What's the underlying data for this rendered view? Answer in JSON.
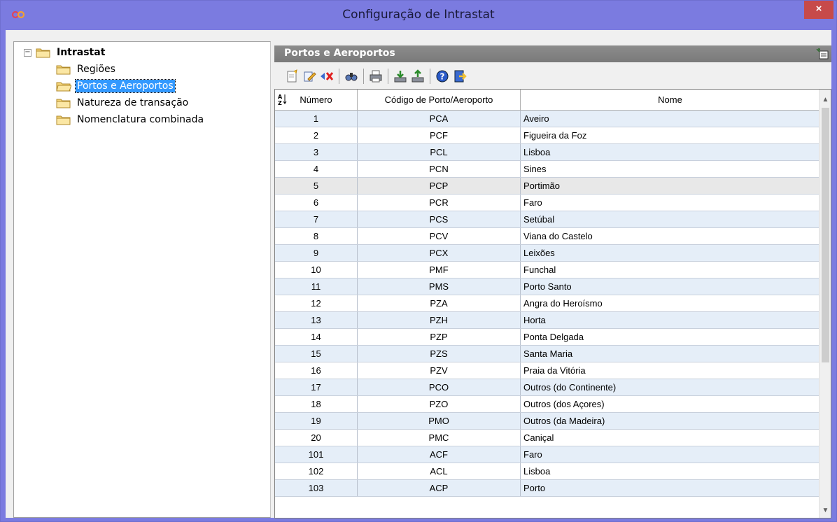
{
  "window": {
    "title": "Configuração de Intrastat",
    "close_label": "×"
  },
  "tree": {
    "root": "Intrastat",
    "expander": "−",
    "items": [
      {
        "label": "Regiões"
      },
      {
        "label": "Portos e Aeroportos",
        "selected": true
      },
      {
        "label": "Natureza de transação"
      },
      {
        "label": "Nomenclatura combinada"
      }
    ]
  },
  "panel": {
    "title": "Portos e Aeroportos",
    "toolbar": [
      "new-icon",
      "edit-icon",
      "delete-icon",
      "find-icon",
      "print-icon",
      "import-icon",
      "export-icon",
      "help-icon",
      "exit-icon"
    ]
  },
  "grid": {
    "columns": [
      "Número",
      "Código de Porto/Aeroporto",
      "Nome"
    ],
    "sort_icon": "A-Z",
    "rows": [
      [
        "1",
        "PCA",
        "Aveiro"
      ],
      [
        "2",
        "PCF",
        "Figueira da Foz"
      ],
      [
        "3",
        "PCL",
        "Lisboa"
      ],
      [
        "4",
        "PCN",
        "Sines"
      ],
      [
        "5",
        "PCP",
        "Portimão"
      ],
      [
        "6",
        "PCR",
        "Faro"
      ],
      [
        "7",
        "PCS",
        "Setúbal"
      ],
      [
        "8",
        "PCV",
        "Viana do Castelo"
      ],
      [
        "9",
        "PCX",
        "Leixões"
      ],
      [
        "10",
        "PMF",
        "Funchal"
      ],
      [
        "11",
        "PMS",
        "Porto Santo"
      ],
      [
        "12",
        "PZA",
        "Angra do Heroísmo"
      ],
      [
        "13",
        "PZH",
        "Horta"
      ],
      [
        "14",
        "PZP",
        "Ponta Delgada"
      ],
      [
        "15",
        "PZS",
        "Santa Maria"
      ],
      [
        "16",
        "PZV",
        "Praia da Vitória"
      ],
      [
        "17",
        "PCO",
        "Outros (do Continente)"
      ],
      [
        "18",
        "PZO",
        "Outros (dos Açores)"
      ],
      [
        "19",
        "PMO",
        "Outros (da Madeira)"
      ],
      [
        "20",
        "PMC",
        "Caniçal"
      ],
      [
        "101",
        "ACF",
        "Faro"
      ],
      [
        "102",
        "ACL",
        "Lisboa"
      ],
      [
        "103",
        "ACP",
        "Porto"
      ]
    ]
  },
  "colors": {
    "titlebar": "#7b7be0",
    "selection": "#3399ff",
    "row_alt": "#e5eef8",
    "close": "#c74a4a"
  }
}
